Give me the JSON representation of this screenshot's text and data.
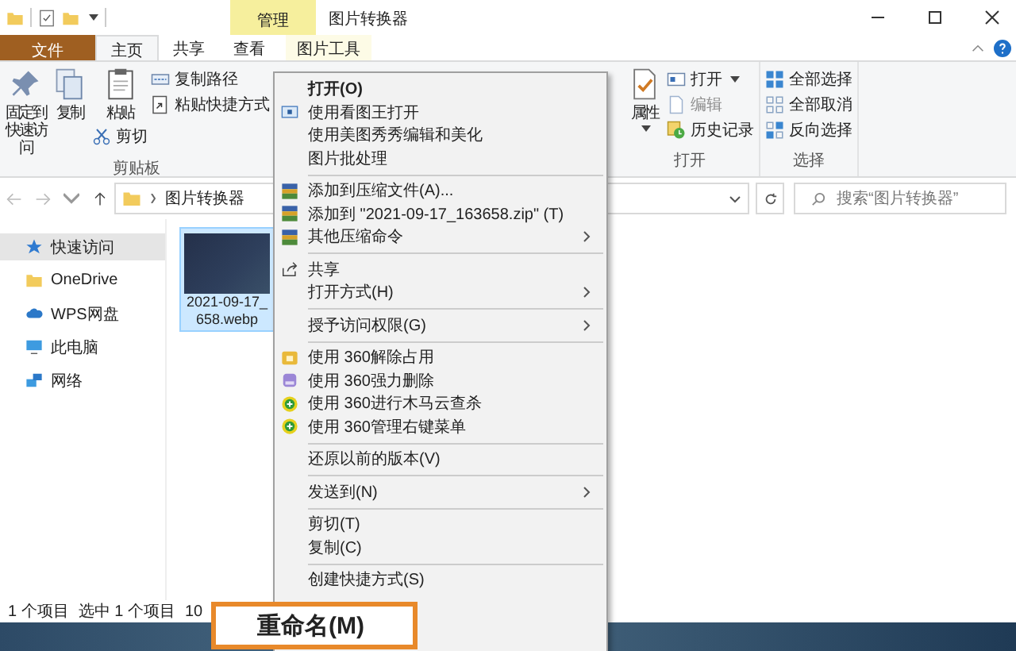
{
  "window": {
    "title": "图片转换器",
    "contextual_group": "管理"
  },
  "ribbon_tabs": [
    {
      "label": "文件",
      "kind": "file",
      "selected": false
    },
    {
      "label": "主页",
      "kind": "tab",
      "selected": true
    },
    {
      "label": "共享",
      "kind": "tab",
      "selected": false
    },
    {
      "label": "查看",
      "kind": "tab",
      "selected": false
    },
    {
      "label": "图片工具",
      "kind": "contextual",
      "selected": false
    }
  ],
  "ribbon_groups": [
    {
      "label": "剪贴板",
      "columns": [
        [
          {
            "label": "固定到快速访问",
            "kind": "large",
            "dropdown": false,
            "disabled": false
          }
        ],
        [
          {
            "label": "复制",
            "kind": "large",
            "dropdown": false,
            "disabled": false
          }
        ],
        [
          {
            "label": "粘贴",
            "kind": "large",
            "dropdown": false,
            "disabled": false
          },
          {
            "label": "剪切",
            "kind": "small",
            "dropdown": false,
            "disabled": false
          }
        ],
        [
          {
            "label": "复制路径",
            "kind": "small",
            "dropdown": false,
            "disabled": false
          },
          {
            "label": "粘贴快捷方式",
            "kind": "small",
            "dropdown": false,
            "disabled": false
          }
        ]
      ]
    },
    {
      "label": "打开",
      "columns": [
        [
          {
            "label": "属性",
            "kind": "large",
            "dropdown": true,
            "disabled": false
          }
        ],
        [
          {
            "label": "打开",
            "kind": "small",
            "dropdown": true,
            "disabled": false
          },
          {
            "label": "编辑",
            "kind": "small",
            "dropdown": false,
            "disabled": true
          },
          {
            "label": "历史记录",
            "kind": "small",
            "dropdown": false,
            "disabled": false
          }
        ]
      ]
    },
    {
      "label": "选择",
      "columns": [
        [
          {
            "label": "全部选择",
            "kind": "small",
            "dropdown": false,
            "disabled": false
          },
          {
            "label": "全部取消",
            "kind": "small",
            "dropdown": false,
            "disabled": false
          },
          {
            "label": "反向选择",
            "kind": "small",
            "dropdown": false,
            "disabled": false
          }
        ]
      ]
    }
  ],
  "address": {
    "path": [
      "图片转换器"
    ]
  },
  "search": {
    "placeholder": "搜索“图片转换器”"
  },
  "navigation": [
    {
      "label": "快速访问",
      "selected": true
    },
    {
      "label": "OneDrive",
      "selected": false
    },
    {
      "label": "WPS网盘",
      "selected": false
    },
    {
      "label": "此电脑",
      "selected": false
    },
    {
      "label": "网络",
      "selected": false
    }
  ],
  "files": [
    {
      "name_lines": [
        "2021-09-17_",
        "658.webp"
      ],
      "selected": true
    }
  ],
  "status_bar": [
    "1 个项目",
    "选中 1 个项目",
    "10"
  ],
  "context_menu": [
    {
      "kind": "item",
      "label": "打开(O)",
      "default": true,
      "submenu": false
    },
    {
      "kind": "item",
      "label": "使用看图王打开",
      "default": false,
      "submenu": false
    },
    {
      "kind": "item",
      "label": "使用美图秀秀编辑和美化",
      "default": false,
      "submenu": false
    },
    {
      "kind": "item",
      "label": "图片批处理",
      "default": false,
      "submenu": false
    },
    {
      "kind": "separator"
    },
    {
      "kind": "item",
      "label": "添加到压缩文件(A)...",
      "default": false,
      "submenu": false
    },
    {
      "kind": "item",
      "label": "添加到 \"2021-09-17_163658.zip\" (T)",
      "default": false,
      "submenu": false
    },
    {
      "kind": "item",
      "label": "其他压缩命令",
      "default": false,
      "submenu": true
    },
    {
      "kind": "separator"
    },
    {
      "kind": "item",
      "label": "共享",
      "default": false,
      "submenu": false
    },
    {
      "kind": "item",
      "label": "打开方式(H)",
      "default": false,
      "submenu": true
    },
    {
      "kind": "separator"
    },
    {
      "kind": "item",
      "label": "授予访问权限(G)",
      "default": false,
      "submenu": true
    },
    {
      "kind": "separator"
    },
    {
      "kind": "item",
      "label": "使用 360解除占用",
      "default": false,
      "submenu": false
    },
    {
      "kind": "item",
      "label": "使用 360强力删除",
      "default": false,
      "submenu": false
    },
    {
      "kind": "item",
      "label": "使用 360进行木马云查杀",
      "default": false,
      "submenu": false
    },
    {
      "kind": "item",
      "label": "使用 360管理右键菜单",
      "default": false,
      "submenu": false
    },
    {
      "kind": "separator"
    },
    {
      "kind": "item",
      "label": "还原以前的版本(V)",
      "default": false,
      "submenu": false
    },
    {
      "kind": "separator"
    },
    {
      "kind": "item",
      "label": "发送到(N)",
      "default": false,
      "submenu": true
    },
    {
      "kind": "separator"
    },
    {
      "kind": "item",
      "label": "剪切(T)",
      "default": false,
      "submenu": false
    },
    {
      "kind": "item",
      "label": "复制(C)",
      "default": false,
      "submenu": false
    },
    {
      "kind": "separator"
    },
    {
      "kind": "item",
      "label": "创建快捷方式(S)",
      "default": false,
      "submenu": false
    }
  ],
  "highlight_callout": {
    "label": "重命名(M)"
  }
}
